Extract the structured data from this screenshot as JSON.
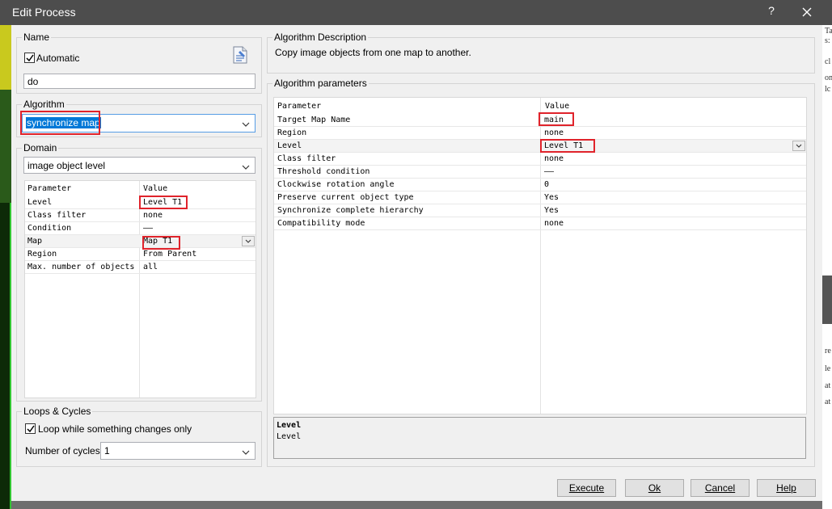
{
  "window": {
    "title": "Edit Process",
    "help_glyph": "?"
  },
  "background": {
    "right_fragments": [
      "Ta",
      "s:",
      "cl",
      "on",
      "lc",
      "re",
      "le",
      "at",
      "at"
    ]
  },
  "name_group": {
    "label": "Name",
    "automatic_label": "Automatic",
    "automatic_checked": true,
    "name_value": "do"
  },
  "algorithm_group": {
    "label": "Algorithm",
    "selected": "synchronize map"
  },
  "domain_group": {
    "label": "Domain",
    "selected": "image object level",
    "header": {
      "param": "Parameter",
      "value": "Value"
    },
    "rows": [
      {
        "param": "Level",
        "value": "Level T1"
      },
      {
        "param": "Class filter",
        "value": "none"
      },
      {
        "param": "Condition",
        "value": "——"
      },
      {
        "param": "Map",
        "value": "Map T1"
      },
      {
        "param": "Region",
        "value": "From Parent"
      },
      {
        "param": "Max. number of objects",
        "value": "all"
      }
    ]
  },
  "loops_group": {
    "label": "Loops & Cycles",
    "loop_label": "Loop while something changes only",
    "loop_checked": true,
    "cycles_label": "Number of cycles",
    "cycles_value": "1"
  },
  "description_group": {
    "label": "Algorithm Description",
    "text": "Copy image objects from one map to another."
  },
  "params_group": {
    "label": "Algorithm parameters",
    "header": {
      "param": "Parameter",
      "value": "Value"
    },
    "rows": [
      {
        "param": "Target Map Name",
        "value": "main"
      },
      {
        "param": "Region",
        "value": "none"
      },
      {
        "param": "Level",
        "value": "Level T1"
      },
      {
        "param": "Class filter",
        "value": "none"
      },
      {
        "param": "Threshold condition",
        "value": "——"
      },
      {
        "param": "Clockwise rotation angle",
        "value": "0"
      },
      {
        "param": "Preserve current object type",
        "value": "Yes"
      },
      {
        "param": "Synchronize complete hierarchy",
        "value": "Yes"
      },
      {
        "param": "Compatibility mode",
        "value": "none"
      }
    ],
    "help_title": "Level",
    "help_text": "Level"
  },
  "buttons": {
    "execute": "Execute",
    "ok": "Ok",
    "cancel": "Cancel",
    "help": "Help"
  }
}
